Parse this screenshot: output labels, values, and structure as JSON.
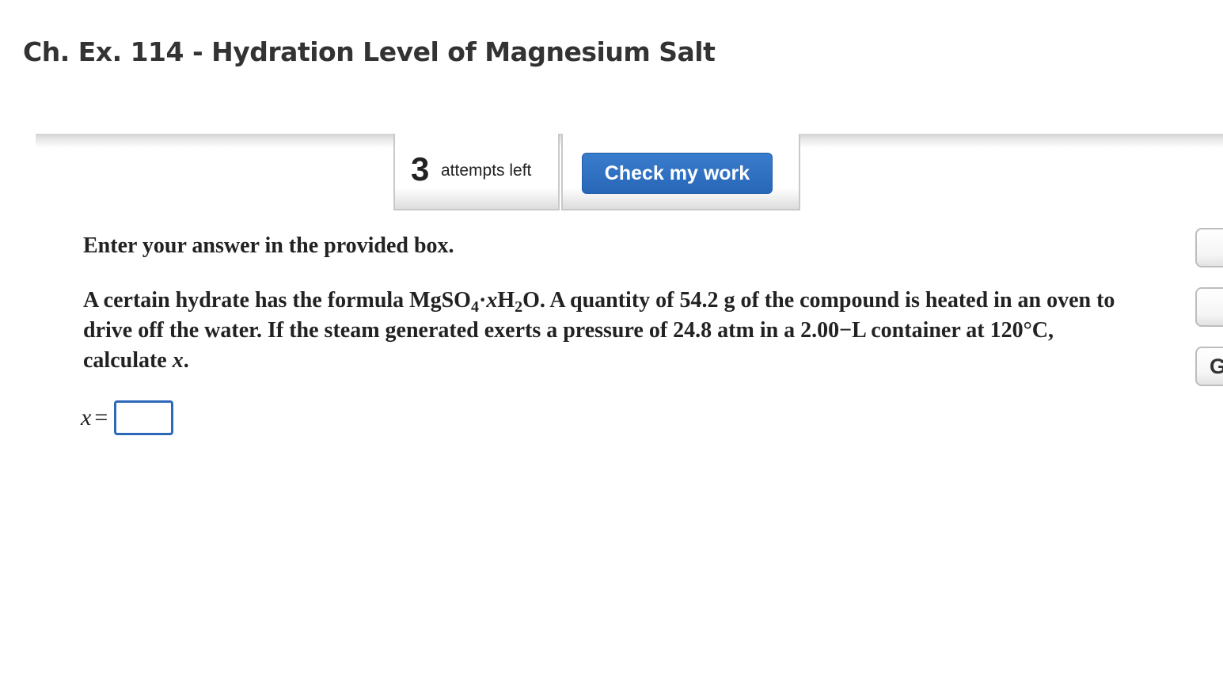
{
  "header": {
    "title": "Ch. Ex. 114 - Hydration Level of Magnesium Salt"
  },
  "toolbar": {
    "attempts_count": "3",
    "attempts_label": "attempts left",
    "check_label": "Check my work"
  },
  "question": {
    "instructions": "Enter your answer in the provided box.",
    "text": {
      "t1": "A certain hydrate has the formula MgSO",
      "s1": "4",
      "t2": "·",
      "v1": "x",
      "t3": "H",
      "s2": "2",
      "t4": "O. A quantity of 54.2 g of the compound is heated in an oven to drive off the water. If the steam generated exerts a pressure of 24.8 atm in a 2.00−L container at 120°C, calculate ",
      "v2": "x",
      "t5": "."
    },
    "answer": {
      "label": "x",
      "equals": "=",
      "value": ""
    }
  },
  "side_tabs": [
    {
      "label": ""
    },
    {
      "label": ""
    },
    {
      "label": "G"
    }
  ],
  "colors": {
    "accent": "#2d6cbd",
    "text": "#222222",
    "border": "#c9c9c9"
  }
}
